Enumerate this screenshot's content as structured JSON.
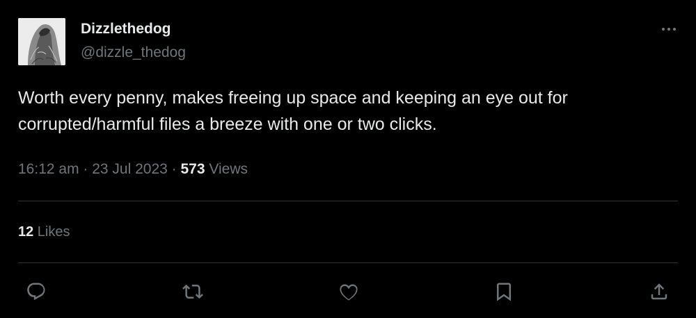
{
  "author": {
    "name": "Dizzlethedog",
    "handle": "@dizzle_thedog"
  },
  "tweet": {
    "text": "Worth every penny, makes freeing up space and keeping an eye out for corrupted/harmful files a breeze with one or two clicks.",
    "time": "16:12 am",
    "separator1": " · ",
    "date": "23 Jul 2023",
    "separator2": " · ",
    "views_count": "573",
    "views_label": " Views"
  },
  "engagement": {
    "likes_count": "12",
    "likes_label": " Likes"
  },
  "icons": {
    "more": "more-horizontal-icon",
    "reply": "reply-icon",
    "retweet": "retweet-icon",
    "like": "heart-icon",
    "bookmark": "bookmark-icon",
    "share": "share-icon"
  },
  "colors": {
    "background": "#000000",
    "primary_text": "#e7e9ea",
    "secondary_text": "#71767b",
    "divider": "#2f3336"
  }
}
